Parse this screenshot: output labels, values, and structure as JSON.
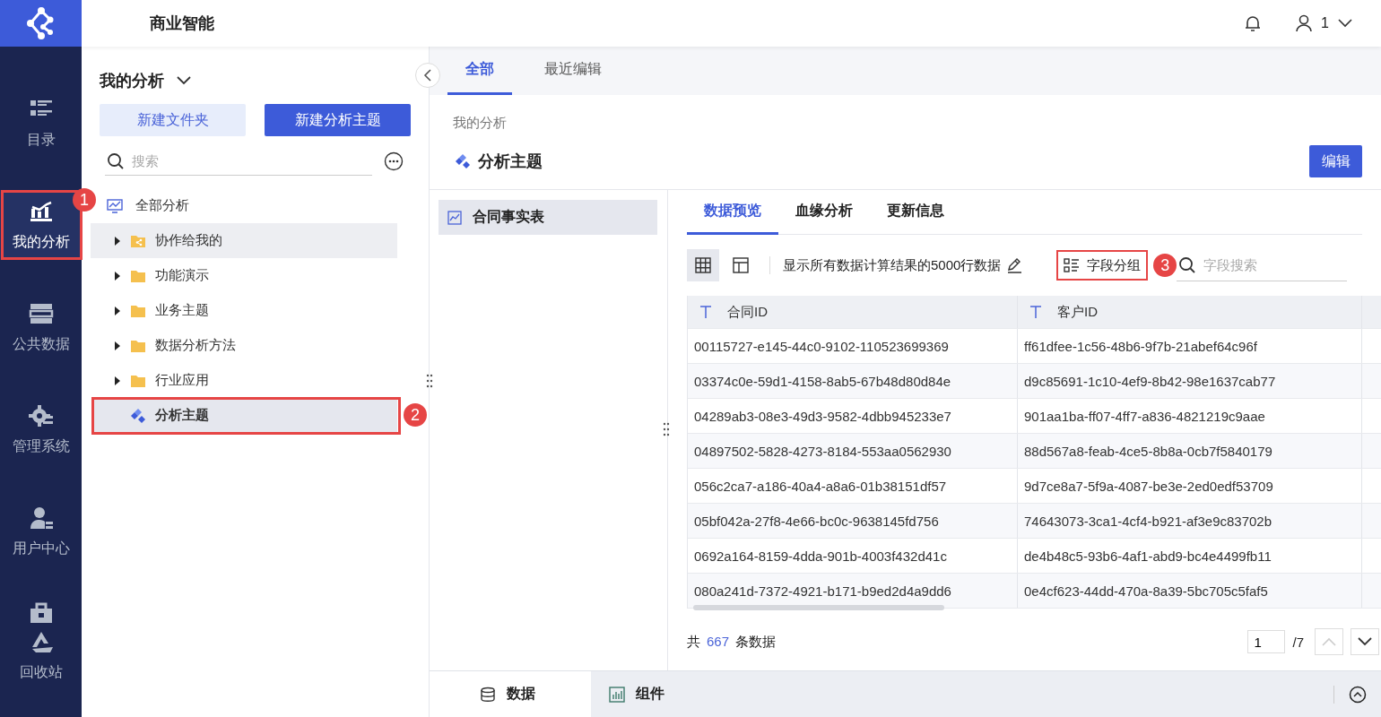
{
  "brand": {
    "title": "商业智能"
  },
  "header": {
    "user": "1"
  },
  "nav": [
    {
      "label": "目录",
      "selected": false
    },
    {
      "label": "我的分析",
      "selected": true,
      "callout": "1"
    },
    {
      "label": "公共数据",
      "selected": false
    },
    {
      "label": "管理系统",
      "selected": false
    },
    {
      "label": "用户中心",
      "selected": false
    },
    {
      "selected": false
    },
    {
      "label": "回收站",
      "selected": false
    }
  ],
  "left_panel": {
    "title": "我的分析",
    "buttons": [
      {
        "label": "新建文件夹",
        "kind": "secondary"
      },
      {
        "label": "新建分析主题",
        "kind": "primary"
      }
    ],
    "search": {
      "placeholder": "搜索"
    },
    "tree": [
      {
        "label": "全部分析",
        "children": [
          {
            "label": "协作给我的",
            "kind": "shared-folder",
            "expanded": false,
            "selected": false,
            "hovered": true
          },
          {
            "label": "功能演示",
            "kind": "folder",
            "expanded": false,
            "selected": false,
            "hovered": false
          },
          {
            "label": "业务主题",
            "kind": "folder",
            "expanded": false,
            "selected": false,
            "hovered": false
          },
          {
            "label": "数据分析方法",
            "kind": "folder",
            "expanded": false,
            "selected": false,
            "hovered": false
          },
          {
            "label": "行业应用",
            "kind": "folder",
            "expanded": false,
            "selected": false,
            "hovered": false
          },
          {
            "label": "分析主题",
            "kind": "topic",
            "selected": true,
            "hovered": false,
            "callout": "2"
          }
        ]
      }
    ]
  },
  "tabs": [
    {
      "label": "全部",
      "selected": true
    },
    {
      "label": "最近编辑",
      "selected": false
    }
  ],
  "breadcrumb": "我的分析",
  "topic": {
    "title": "分析主题",
    "edit_button": "编辑"
  },
  "tables": [
    {
      "label": "合同事实表",
      "selected": true
    }
  ],
  "sub_tabs": [
    {
      "label": "数据预览",
      "selected": true
    },
    {
      "label": "血缘分析",
      "selected": false
    },
    {
      "label": "更新信息",
      "selected": false
    }
  ],
  "toolbar": {
    "views": [
      {
        "kind": "grid",
        "selected": true
      },
      {
        "kind": "layout",
        "selected": false
      }
    ],
    "info": "显示所有数据计算结果的5000行数据",
    "group_button": {
      "label": "字段分组",
      "callout": "3"
    },
    "field_search": {
      "placeholder": "字段搜索"
    }
  },
  "table": {
    "columns": [
      "合同ID",
      "客户ID"
    ],
    "rows": [
      [
        "00115727-e145-44c0-9102-110523699369",
        "ff61dfee-1c56-48b6-9f7b-21abef64c96f"
      ],
      [
        "03374c0e-59d1-4158-8ab5-67b48d80d84e",
        "d9c85691-1c10-4ef9-8b42-98e1637cab77"
      ],
      [
        "04289ab3-08e3-49d3-9582-4dbb945233e7",
        "901aa1ba-ff07-4ff7-a836-4821219c9aae"
      ],
      [
        "04897502-5828-4273-8184-553aa0562930",
        "88d567a8-feab-4ce5-8b8a-0cb7f5840179"
      ],
      [
        "056c2ca7-a186-40a4-a8a6-01b38151df57",
        "9d7ce8a7-5f9a-4087-be3e-2ed0edf53709"
      ],
      [
        "05bf042a-27f8-4e66-bc0c-9638145fd756",
        "74643073-3ca1-4cf4-b921-af3e9c83702b"
      ],
      [
        "0692a164-8159-4dda-901b-4003f432d41c",
        "de4b48c5-93b6-4af1-abd9-bc4e4499fb11"
      ],
      [
        "080a241d-7372-4921-b171-b9ed2d4a9dd6",
        "0e4cf623-44dd-470a-8a39-5bc705c5faf5"
      ]
    ]
  },
  "footer": {
    "prefix": "共",
    "count": "667",
    "suffix": "条数据",
    "page": "1",
    "total": "/7"
  },
  "bottom_tabs": [
    {
      "label": "数据",
      "selected": true
    },
    {
      "label": "组件",
      "selected": false
    }
  ]
}
